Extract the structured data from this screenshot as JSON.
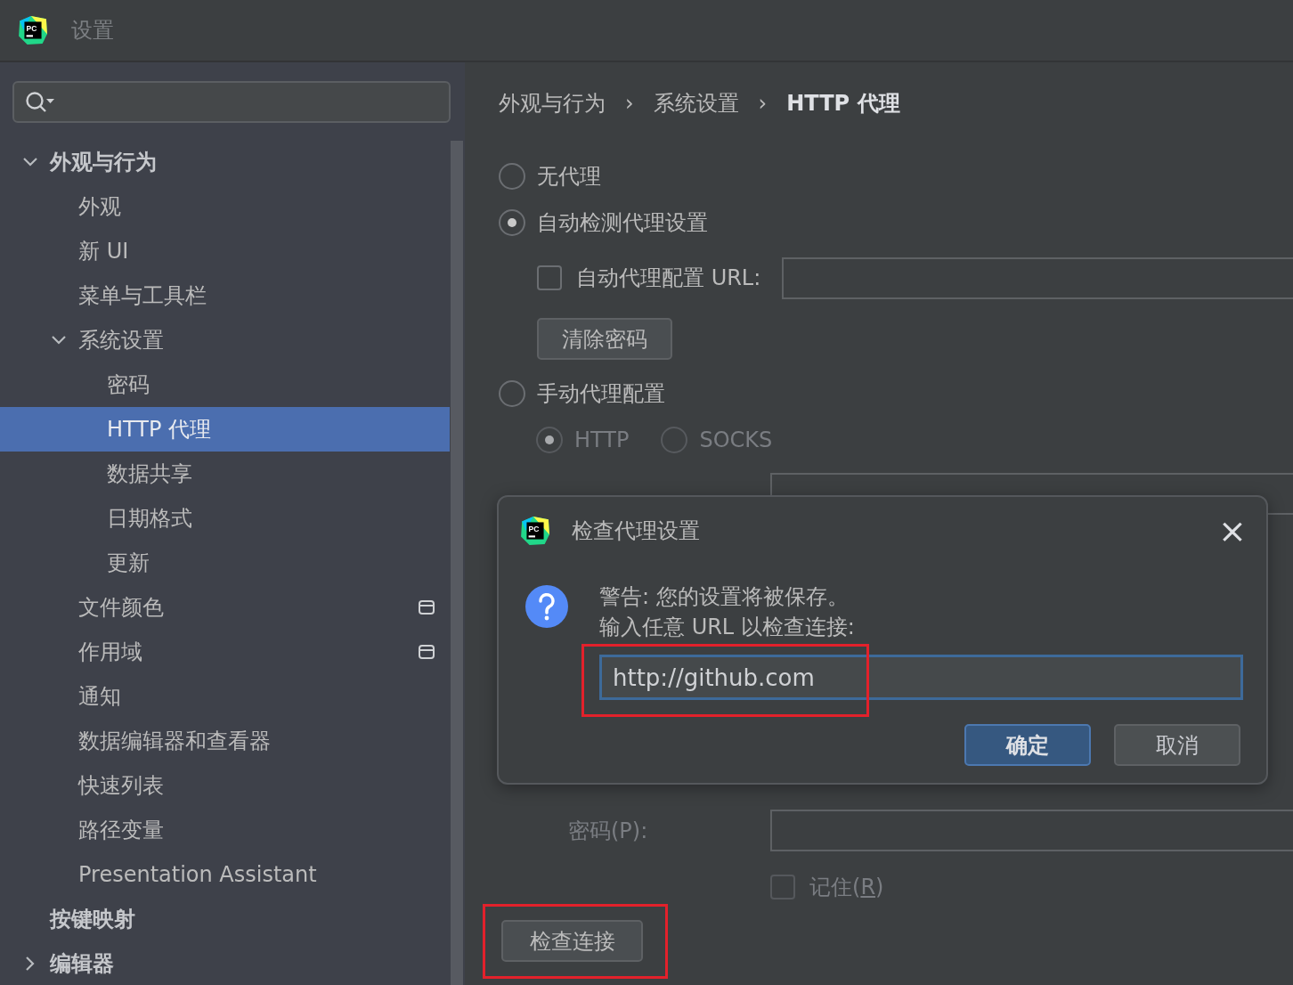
{
  "window": {
    "title": "设置",
    "logo_text": "PC"
  },
  "sidebar": {
    "items": [
      {
        "label": "外观与行为",
        "expanded": true,
        "selected": false,
        "children": [
          {
            "label": "外观",
            "selected": false
          },
          {
            "label": "新 UI",
            "selected": false
          },
          {
            "label": "菜单与工具栏",
            "selected": false
          },
          {
            "label": "系统设置",
            "expanded": true,
            "selected": false,
            "children": [
              {
                "label": "密码",
                "selected": false
              },
              {
                "label": "HTTP 代理",
                "selected": true
              },
              {
                "label": "数据共享",
                "selected": false
              },
              {
                "label": "日期格式",
                "selected": false
              },
              {
                "label": "更新",
                "selected": false
              }
            ]
          },
          {
            "label": "文件颜色",
            "selected": false,
            "project_level": true
          },
          {
            "label": "作用域",
            "selected": false,
            "project_level": true
          },
          {
            "label": "通知",
            "selected": false
          },
          {
            "label": "数据编辑器和查看器",
            "selected": false
          },
          {
            "label": "快速列表",
            "selected": false
          },
          {
            "label": "路径变量",
            "selected": false
          },
          {
            "label": "Presentation Assistant",
            "selected": false
          }
        ]
      },
      {
        "label": "按键映射",
        "selected": false
      },
      {
        "label": "编辑器",
        "expanded": false,
        "selected": false
      }
    ]
  },
  "breadcrumb": [
    "外观与行为",
    "系统设置",
    "HTTP 代理"
  ],
  "breadcrumb_separator": "›",
  "proxy_options": [
    {
      "label": "无代理",
      "selected": false
    },
    {
      "label": "自动检测代理设置",
      "selected": true
    },
    {
      "label": "手动代理配置",
      "selected": false
    }
  ],
  "auto_config": {
    "checkbox": {
      "label": "自动代理配置 URL:",
      "checked": false
    },
    "clear_button": "清除密码"
  },
  "manual": {
    "protocols": [
      {
        "label": "HTTP",
        "selected": true,
        "disabled": true
      },
      {
        "label": "SOCKS",
        "selected": false,
        "disabled": true
      }
    ],
    "password": {
      "label": "密码(P):",
      "disabled": true
    },
    "remember": {
      "label": "记住(R)",
      "checked": false,
      "disabled": true,
      "mnemonic_underlined": true
    }
  },
  "check_button": {
    "label": "检查连接",
    "highlighted": true
  },
  "dialog": {
    "title": "检查代理设置",
    "logo_text": "PC",
    "close": "×",
    "message": [
      "警告: 您的设置将被保存。",
      "输入任意 URL 以检查连接:"
    ],
    "url_field": {
      "value": "http://github.com",
      "focused": true,
      "highlighted": true
    },
    "buttons": [
      {
        "label": "确定",
        "kind": "default"
      },
      {
        "label": "取消",
        "kind": "normal"
      }
    ]
  }
}
